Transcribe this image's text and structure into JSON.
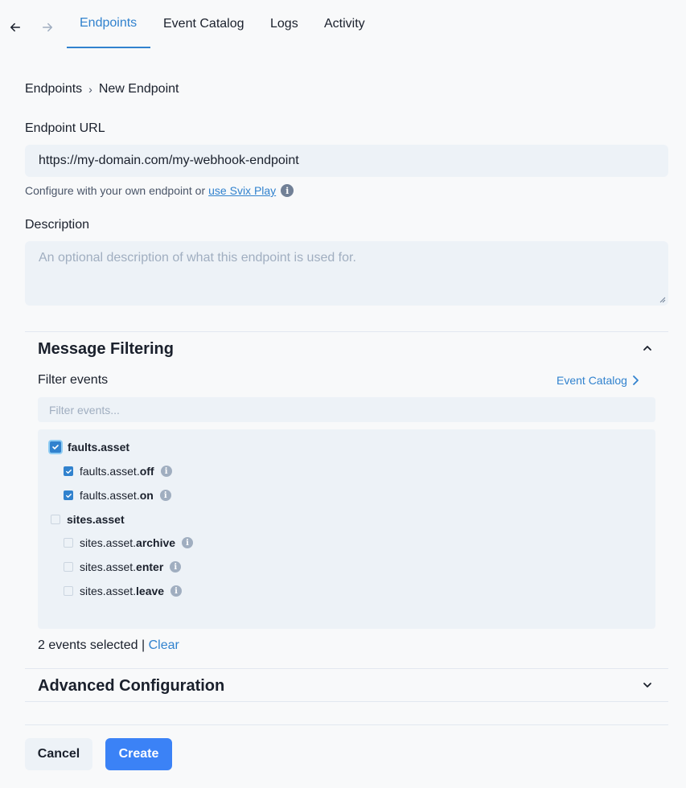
{
  "nav": {
    "tabs": [
      {
        "label": "Endpoints"
      },
      {
        "label": "Event Catalog"
      },
      {
        "label": "Logs"
      },
      {
        "label": "Activity"
      }
    ]
  },
  "breadcrumb": {
    "parent": "Endpoints",
    "separator": "›",
    "current": "New Endpoint"
  },
  "form": {
    "url_label": "Endpoint URL",
    "url_value": "https://my-domain.com/my-webhook-endpoint",
    "helper_text": "Configure with your own endpoint or",
    "helper_link": "use Svix Play",
    "description_label": "Description",
    "description_placeholder": "An optional description of what this endpoint is used for."
  },
  "filtering": {
    "title": "Message Filtering",
    "filter_label": "Filter events",
    "catalog_link": "Event Catalog",
    "filter_placeholder": "Filter events...",
    "groups": [
      {
        "name": "faults.asset",
        "checked": true,
        "events": [
          {
            "prefix": "faults.asset.",
            "suffix": "off",
            "checked": true
          },
          {
            "prefix": "faults.asset.",
            "suffix": "on",
            "checked": true
          }
        ]
      },
      {
        "name": "sites.asset",
        "checked": false,
        "events": [
          {
            "prefix": "sites.asset.",
            "suffix": "archive",
            "checked": false
          },
          {
            "prefix": "sites.asset.",
            "suffix": "enter",
            "checked": false
          },
          {
            "prefix": "sites.asset.",
            "suffix": "leave",
            "checked": false
          }
        ]
      }
    ],
    "selected_text": "2 events selected |",
    "clear_label": "Clear"
  },
  "advanced": {
    "title": "Advanced Configuration"
  },
  "actions": {
    "cancel_label": "Cancel",
    "create_label": "Create"
  },
  "colors": {
    "accent": "#3182ce",
    "primary_button": "#3b82f6",
    "input_bg": "#edf2f7"
  }
}
